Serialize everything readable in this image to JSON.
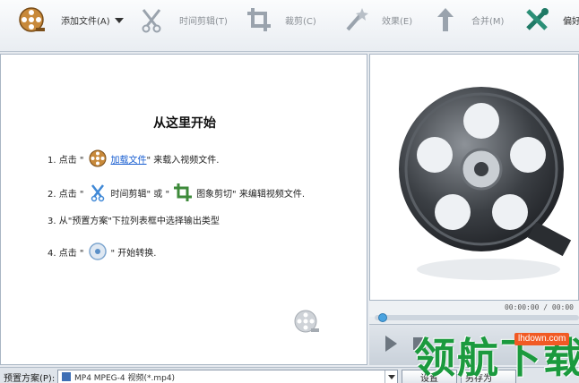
{
  "toolbar": {
    "add_file": "添加文件(A)",
    "trim": "时间剪辑(T)",
    "crop": "裁剪(C)",
    "effects": "效果(E)",
    "merge": "合并(M)",
    "prefs": "偏好"
  },
  "intro": {
    "title": "从这里开始",
    "step1_prefix": "1. 点击 \"",
    "step1_link": "加载文件",
    "step1_suffix": "\" 来载入视频文件.",
    "step2_prefix": "2. 点击 \"",
    "step2_mid1": "时间剪辑\" 或 \"",
    "step2_mid2": "图象剪切\" 来编辑视频文件.",
    "step3": "3. 从\"预置方案\"下拉列表框中选择输出类型",
    "step4_prefix": "4. 点击 \"",
    "step4_suffix": "\" 开始转换."
  },
  "player": {
    "time": "00:00:00 / 00:00"
  },
  "bottom": {
    "preset_label": "预置方案(P):",
    "preset_value": "MP4 MPEG-4 视频(*.mp4)",
    "settings": "设置",
    "save_as": "另存为"
  },
  "watermark": {
    "url": "lhdown.com",
    "text": "领航下载"
  },
  "colors": {
    "accent": "#4aa3e0",
    "link": "#1a5fd1",
    "watermark_green": "#1b9a3e",
    "watermark_orange": "#f15a24"
  }
}
